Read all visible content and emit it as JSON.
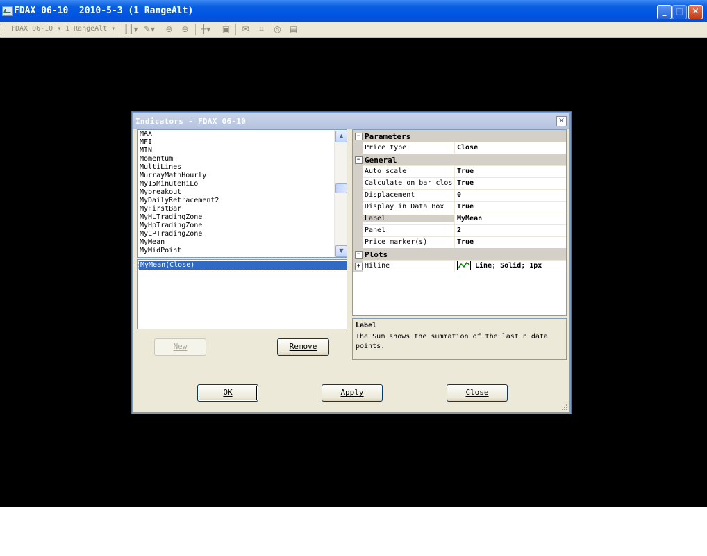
{
  "window": {
    "title": "FDAX 06-10  2010-5-3 (1 RangeAlt)",
    "buttons": {
      "minimize": "_",
      "maximize": "□",
      "close": "✕"
    }
  },
  "toolbar": {
    "instrument": "FDAX 06-10 ▾",
    "period": "1 RangeAlt ▾",
    "icons": [
      "bar-style-icon",
      "draw-pen-icon",
      "zoom-in-icon",
      "zoom-out-icon",
      "crosshair-icon",
      "data-box-icon",
      "chat-icon",
      "strategies-icon",
      "properties-icon",
      "grid-icon"
    ]
  },
  "dialog": {
    "title": "Indicators - FDAX 06-10",
    "indicators": [
      "MAX",
      "MFI",
      "MIN",
      "Momentum",
      "MultiLines",
      "MurrayMathHourly",
      "My15MinuteHiLo",
      "Mybreakout",
      "MyDailyRetracement2",
      "MyFirstBar",
      "MyHLTradingZone",
      "MyHpTradingZone",
      "MyLPTradingZone",
      "MyMean",
      "MyMidPoint"
    ],
    "applied": [
      "MyMean(Close)"
    ],
    "new_label": "New",
    "remove_label": "Remove",
    "ok_label": "OK",
    "apply_label": "Apply",
    "close_label": "Close",
    "properties": {
      "parameters": {
        "label": "Parameters",
        "toggle": "⊟",
        "rows": [
          {
            "name": "Price type",
            "value": "Close"
          }
        ]
      },
      "general": {
        "label": "General",
        "toggle": "⊟",
        "rows": [
          {
            "name": "Auto scale",
            "value": "True"
          },
          {
            "name": "Calculate on bar close",
            "value": "True"
          },
          {
            "name": "Displacement",
            "value": "0"
          },
          {
            "name": "Display in Data Box",
            "value": "True"
          },
          {
            "name": "Label",
            "value": "MyMean"
          },
          {
            "name": "Panel",
            "value": "2"
          },
          {
            "name": "Price marker(s)",
            "value": "True"
          }
        ]
      },
      "plots": {
        "label": "Plots",
        "toggle": "⊟",
        "rows": [
          {
            "name": "Hiline",
            "value": "Line; Solid; 1px",
            "expand": "+"
          }
        ]
      }
    },
    "help": {
      "title": "Label",
      "text": "The Sum shows the summation of the last n data points."
    },
    "colors": {
      "selection": "#316ac5",
      "swatch_line": "#008000"
    }
  }
}
